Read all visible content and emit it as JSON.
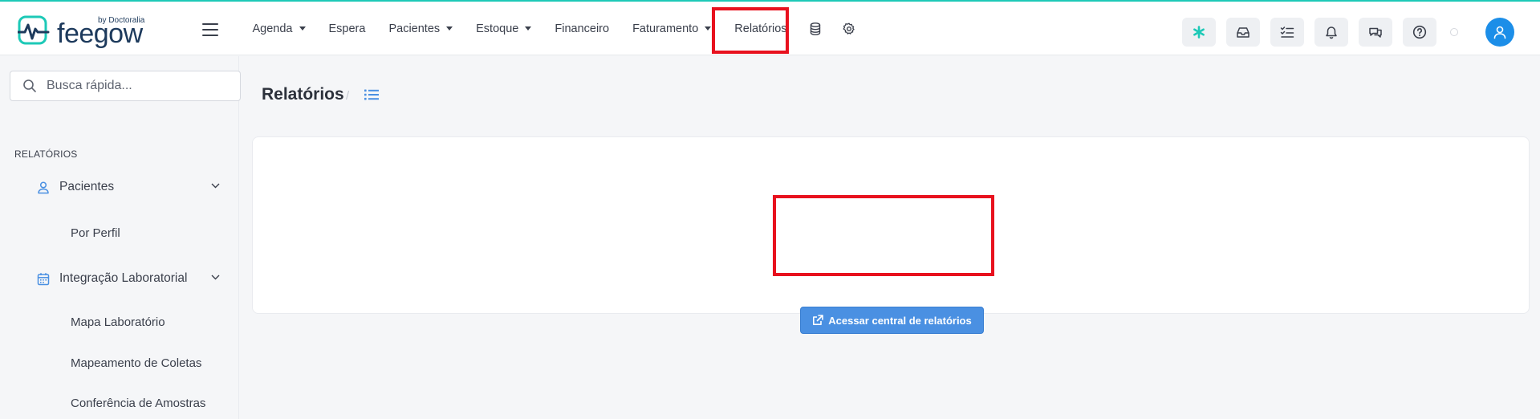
{
  "brand": {
    "name": "feegow",
    "byline": "by Doctoralia",
    "accent_color": "#1dc9b7",
    "logo_color": "#1d3a5c"
  },
  "nav": {
    "items": [
      {
        "label": "Agenda",
        "has_dropdown": true
      },
      {
        "label": "Espera",
        "has_dropdown": false
      },
      {
        "label": "Pacientes",
        "has_dropdown": true
      },
      {
        "label": "Estoque",
        "has_dropdown": true
      },
      {
        "label": "Financeiro",
        "has_dropdown": false
      },
      {
        "label": "Faturamento",
        "has_dropdown": true
      },
      {
        "label": "Relatórios",
        "has_dropdown": false,
        "highlighted": true
      }
    ],
    "icons": [
      "database-icon",
      "gear-icon"
    ]
  },
  "toolbar": {
    "buttons": [
      "asterisk-icon",
      "inbox-icon",
      "checklist-icon",
      "bell-icon",
      "chat-icon",
      "help-icon"
    ],
    "avatar_color": "#1c8ee8"
  },
  "search": {
    "placeholder": "Busca rápida..."
  },
  "sidebar": {
    "section_title": "RELATÓRIOS",
    "groups": [
      {
        "label": "Pacientes",
        "icon": "user-icon",
        "children": [
          "Por Perfil"
        ]
      },
      {
        "label": "Integração Laboratorial",
        "icon": "calendar-icon",
        "children": [
          "Mapa Laboratório",
          "Mapeamento de Coletas",
          "Conferência de Amostras"
        ]
      }
    ]
  },
  "page": {
    "title": "Relatórios",
    "breadcrumb_separator": "/",
    "cta_label": "Acessar central de relatórios",
    "cta_color": "#4a90e2",
    "highlight_color": "#e8111e"
  }
}
